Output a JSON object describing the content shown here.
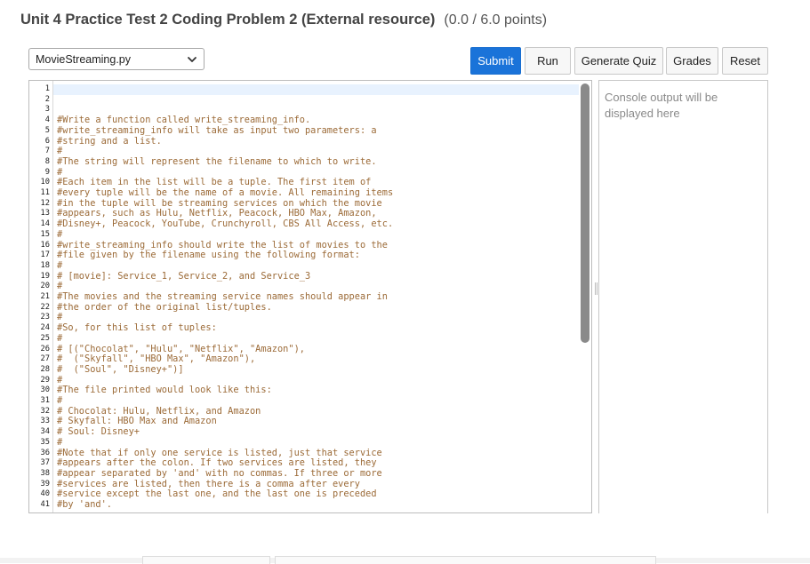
{
  "header": {
    "title": "Unit 4 Practice Test 2 Coding Problem 2 (External resource)",
    "points": "(0.0 / 6.0 points)"
  },
  "file_select": {
    "value": "MovieStreaming.py",
    "icon": "chevron-down-icon"
  },
  "toolbar": {
    "submit_label": "Submit",
    "run_label": "Run",
    "quiz_label": "Generate Quiz",
    "grades_label": "Grades",
    "reset_label": "Reset",
    "accent_color": "#1a73d9"
  },
  "editor": {
    "line_numbers": [
      "1",
      "2",
      "3",
      "4",
      "5",
      "6",
      "7",
      "8",
      "9",
      "10",
      "11",
      "12",
      "13",
      "14",
      "15",
      "16",
      "17",
      "18",
      "19",
      "20",
      "21",
      "22",
      "23",
      "24",
      "25",
      "26",
      "27",
      "28",
      "29",
      "30",
      "31",
      "32",
      "33",
      "34",
      "35",
      "36",
      "37",
      "38",
      "39",
      "40",
      "41"
    ],
    "lines": [
      "",
      "",
      "",
      "#Write a function called write_streaming_info.",
      "#write_streaming_info will take as input two parameters: a",
      "#string and a list.",
      "#",
      "#The string will represent the filename to which to write.",
      "#",
      "#Each item in the list will be a tuple. The first item of",
      "#every tuple will be the name of a movie. All remaining items",
      "#in the tuple will be streaming services on which the movie",
      "#appears, such as Hulu, Netflix, Peacock, HBO Max, Amazon,",
      "#Disney+, Peacock, YouTube, Crunchyroll, CBS All Access, etc.",
      "#",
      "#write_streaming_info should write the list of movies to the",
      "#file given by the filename using the following format:",
      "#",
      "# [movie]: Service_1, Service_2, and Service_3",
      "#",
      "#The movies and the streaming service names should appear in",
      "#the order of the original list/tuples.",
      "#",
      "#So, for this list of tuples:",
      "#",
      "# [(\"Chocolat\", \"Hulu\", \"Netflix\", \"Amazon\"),",
      "#  (\"Skyfall\", \"HBO Max\", \"Amazon\"),",
      "#  (\"Soul\", \"Disney+\")]",
      "#",
      "#The file printed would look like this:",
      "#",
      "# Chocolat: Hulu, Netflix, and Amazon",
      "# Skyfall: HBO Max and Amazon",
      "# Soul: Disney+",
      "#",
      "#Note that if only one service is listed, just that service",
      "#appears after the colon. If two services are listed, they",
      "#appear separated by 'and' with no commas. If three or more",
      "#services are listed, then there is a comma after every",
      "#service except the last one, and the last one is preceded",
      "#by 'and'."
    ],
    "comment_color": "#9c6b38",
    "active_line_color": "#e8f2fe"
  },
  "console": {
    "placeholder": "Console output will be displayed here"
  }
}
